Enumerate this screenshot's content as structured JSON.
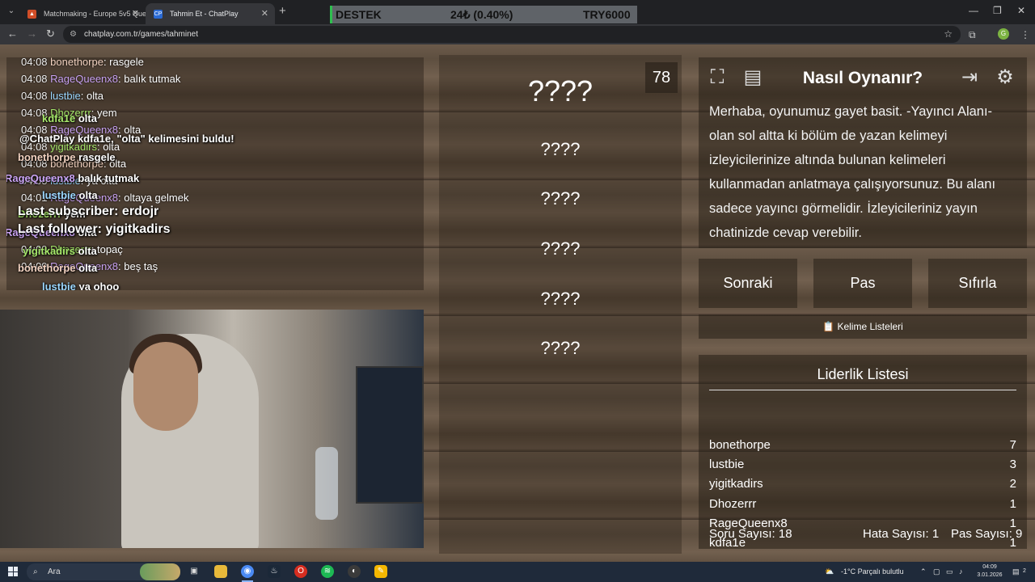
{
  "browser": {
    "tabs": [
      {
        "title": "Matchmaking - Europe 5v5 Que",
        "favicon": "faceit-icon"
      },
      {
        "title": "Tahmin Et - ChatPlay",
        "favicon": "CP"
      }
    ],
    "url": "chatplay.com.tr/games/tahminet",
    "ticker": {
      "left": "DESTEK",
      "middle": "24₺ (0.40%)",
      "right": "TRY6000"
    },
    "profile_initial": "G"
  },
  "chat": {
    "lines": [
      {
        "time": "04:08",
        "user": "bonethorpe",
        "msg": ": rasgele",
        "cls": "c1"
      },
      {
        "time": "04:08",
        "user": "RageQueenx8",
        "msg": ": balık tutmak",
        "cls": "c2"
      },
      {
        "time": "04:08",
        "user": "lustbie",
        "msg": ": olta",
        "cls": "c3"
      },
      {
        "time": "04:08",
        "user": "Dhozerrr",
        "msg": ": yem",
        "cls": "c4"
      },
      {
        "time": "04:08",
        "user": "RageQueenx8",
        "msg": ": olta",
        "cls": "c2"
      },
      {
        "time": "04:08",
        "user": "yigitkadirs",
        "msg": ": olta",
        "cls": "c4"
      },
      {
        "time": "04:08",
        "user": "bonethorpe",
        "msg": ": olta",
        "cls": "c1"
      },
      {
        "time": "04:08",
        "user": "lustbie",
        "msg": ": ya olta",
        "cls": "c3"
      },
      {
        "time": "04:01",
        "user": "RageQueenx8",
        "msg": ": oltaya gelmek",
        "cls": "c2"
      },
      {
        "time": "04:09",
        "user": "Dhozerrr",
        "msg": ": topaç",
        "cls": "c4"
      },
      {
        "time": "04:09",
        "user": "RageQueenx8",
        "msg": ": beş taş",
        "cls": "c2"
      }
    ],
    "overlay": [
      {
        "user": "kdfa1e",
        "msg": "olta",
        "cls": "c4"
      },
      {
        "user": "@ChatPlay",
        "msg": "kdfa1e, \"olta\" kelimesini buldu!",
        "cls": ""
      },
      {
        "user": "bonethorpe",
        "msg": "rasgele",
        "cls": "c1"
      },
      {
        "user": "RageQueenx8",
        "msg": "balık tutmak",
        "cls": "c2"
      },
      {
        "user": "lustbie",
        "msg": "olta",
        "cls": "c3"
      },
      {
        "user": "Dhozerrr",
        "msg": "yem",
        "cls": "c4"
      },
      {
        "user": "RageQueenx8",
        "msg": "olta",
        "cls": "c2"
      },
      {
        "user": "yigitkadirs",
        "msg": "olta",
        "cls": "c4"
      },
      {
        "user": "bonethorpe",
        "msg": "olta",
        "cls": "c1"
      },
      {
        "user": "lustbie",
        "msg": "ya ohoo",
        "cls": "c3"
      }
    ],
    "last_subscriber": "Last subscriber: erdojr",
    "last_follower": "Last follower: yigitkadirs"
  },
  "game": {
    "timer": "78",
    "words": [
      "????",
      "????",
      "????",
      "????",
      "????",
      "????"
    ]
  },
  "howto": {
    "title": "Nasıl Oynanır?",
    "body": "Merhaba, oyunumuz gayet basit. -Yayıncı Alanı- olan sol altta ki bölüm de yazan kelimeyi izleyicilerinize altında bulunan kelimeleri kullanmadan anlatmaya çalışıyorsunuz. Bu alanı sadece yayıncı görmelidir. İzleyicileriniz yayın chatinizde cevap verebilir."
  },
  "actions": {
    "next": "Sonraki",
    "pass": "Pas",
    "reset": "Sıfırla",
    "word_lists": "Kelime Listeleri"
  },
  "leaderboard": {
    "title": "Liderlik Listesi",
    "rows": [
      {
        "name": "bonethorpe",
        "score": "7"
      },
      {
        "name": "lustbie",
        "score": "3"
      },
      {
        "name": "yigitkadirs",
        "score": "2"
      },
      {
        "name": "Dhozerrr",
        "score": "1"
      },
      {
        "name": "RageQueenx8",
        "score": "1"
      },
      {
        "name": "kdfa1e",
        "score": "1"
      }
    ],
    "questions": "Soru Sayısı: 18",
    "errors": "Hata Sayısı: 1",
    "passes": "Pas Sayısı: 9"
  },
  "taskbar": {
    "search_placeholder": "Ara",
    "weather": "-1°C  Parçalı bulutlu",
    "time": "04:09",
    "date": "3.01.2026",
    "notifications": "2"
  }
}
